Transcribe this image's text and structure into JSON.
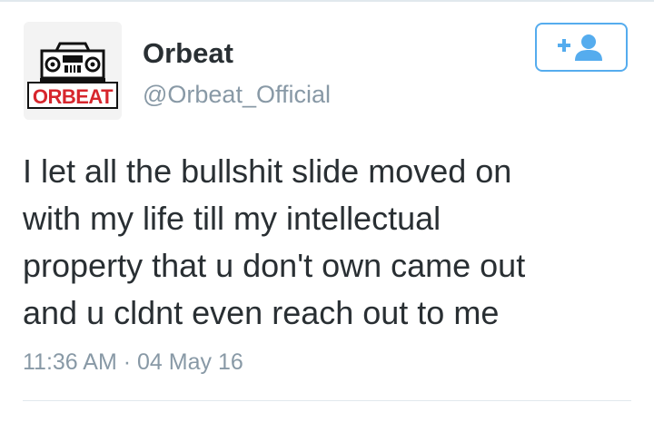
{
  "author": {
    "display_name": "Orbeat",
    "handle": "@Orbeat_Official",
    "avatar_logo_text": "ORBEAT",
    "avatar_icon": "boombox-logo"
  },
  "follow_button": {
    "icon": "follow-user-plus-icon",
    "accent_color": "#55acee"
  },
  "tweet": {
    "lines": [
      "I let all the bullshit slide moved on",
      "with my life till my intellectual",
      "property that u don't own came out",
      "and u cldnt even reach out to me"
    ],
    "time": "11:36 AM",
    "separator": "·",
    "date": "04 May 16"
  },
  "colors": {
    "text_primary": "#292f33",
    "text_secondary": "#8899a6",
    "logo_red": "#d7262d",
    "divider": "#e1e8ed"
  }
}
